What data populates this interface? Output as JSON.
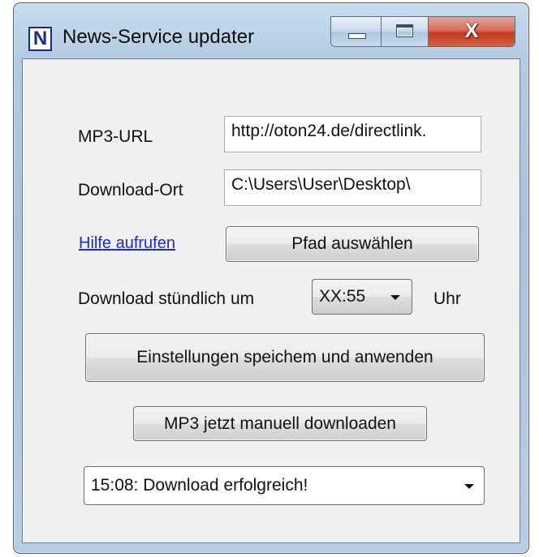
{
  "window": {
    "app_icon_letter": "N",
    "title": "News-Service updater",
    "close_glyph": "X"
  },
  "form": {
    "mp3_url_label": "MP3-URL",
    "mp3_url_value": "http://oton24.de/directlink.",
    "download_location_label": "Download-Ort",
    "download_location_value": "C:\\Users\\User\\Desktop\\",
    "help_link": "Hilfe aufrufen",
    "choose_path_button": "Pfad auswählen",
    "hourly_label": "Download stündlich um",
    "hourly_selected": "XX:55",
    "hourly_suffix": "Uhr",
    "save_apply_button": "Einstellungen speichem und anwenden",
    "manual_download_button": "MP3 jetzt manuell downloaden",
    "log_selected": "15:08: Download erfolgreich!"
  },
  "icons": [
    "app-n-icon",
    "minimize-icon",
    "maximize-icon",
    "close-icon",
    "chevron-down-icon"
  ]
}
